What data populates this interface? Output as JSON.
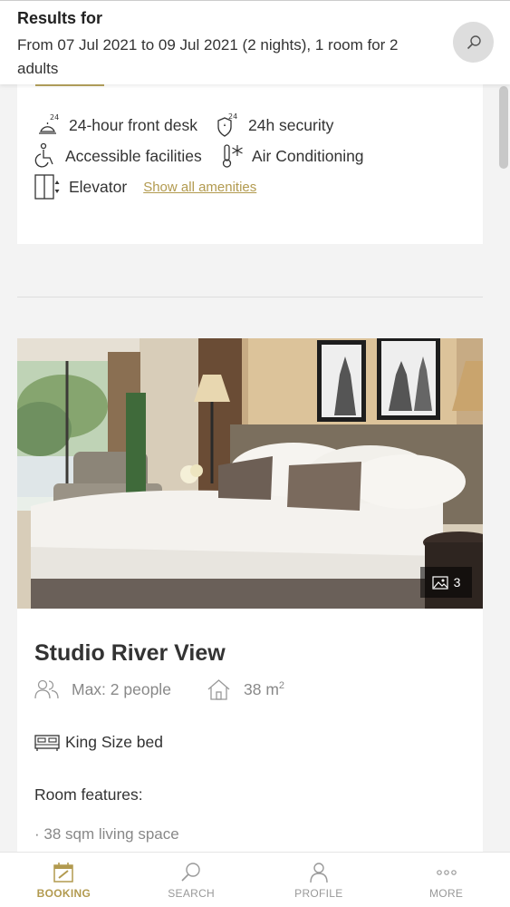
{
  "header": {
    "title": "Results for",
    "dates": "From 07 Jul 2021 to 09 Jul 2021 (2 nights), 1 room for 2 adults"
  },
  "amenities": {
    "items": [
      {
        "label": "24-hour front desk",
        "icon": "front-desk-bell-icon"
      },
      {
        "label": "24h security",
        "icon": "security-shield-icon"
      },
      {
        "label": "Accessible facilities",
        "icon": "wheelchair-icon"
      },
      {
        "label": "Air Conditioning",
        "icon": "thermometer-snowflake-icon"
      },
      {
        "label": "Elevator",
        "icon": "elevator-icon"
      }
    ],
    "show_all": "Show all amenities"
  },
  "room": {
    "name": "Studio River View",
    "photo_count": "3",
    "capacity": "Max: 2 people",
    "area": "38 m",
    "area_unit_sup": "2",
    "bed": "King Size bed",
    "features_title": "Room features:",
    "features": [
      "38 sqm living space"
    ]
  },
  "nav": {
    "items": [
      {
        "label": "BOOKING",
        "icon": "booking-icon",
        "active": true
      },
      {
        "label": "SEARCH",
        "icon": "search-icon",
        "active": false
      },
      {
        "label": "PROFILE",
        "icon": "profile-icon",
        "active": false
      },
      {
        "label": "MORE",
        "icon": "more-icon",
        "active": false
      }
    ]
  },
  "colors": {
    "accent": "#b29a4f",
    "muted_text": "#888888"
  }
}
